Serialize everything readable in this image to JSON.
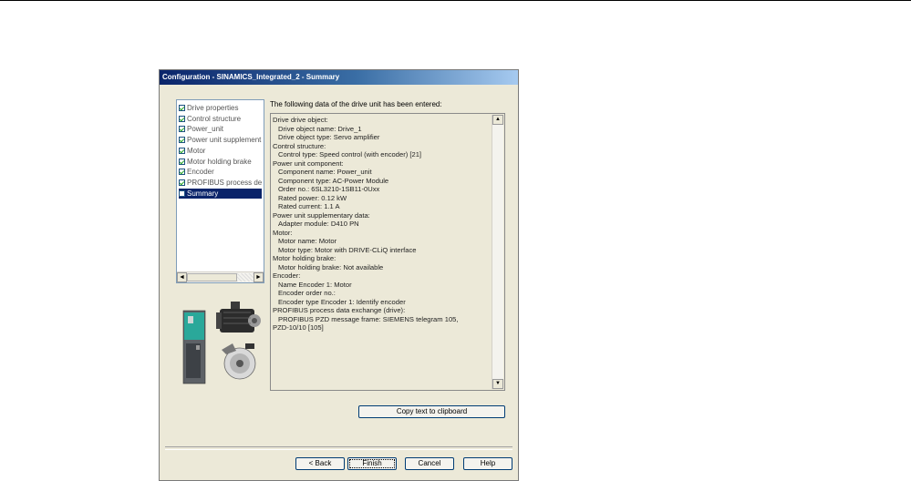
{
  "dialog": {
    "title": "Configuration - SINAMICS_Integrated_2 - Summary"
  },
  "tree": {
    "items": [
      {
        "label": "Drive properties",
        "checked": true
      },
      {
        "label": "Control structure",
        "checked": true
      },
      {
        "label": "Power_unit",
        "checked": true
      },
      {
        "label": "Power unit supplement",
        "checked": true
      },
      {
        "label": "Motor",
        "checked": true
      },
      {
        "label": "Motor holding brake",
        "checked": true
      },
      {
        "label": "Encoder",
        "checked": true
      },
      {
        "label": "PROFIBUS process de",
        "checked": true
      },
      {
        "label": "Summary",
        "checked": false,
        "selected": true
      }
    ],
    "scroll_left": "◄",
    "scroll_right": "►"
  },
  "summary": {
    "intro": "The following data of the drive unit has been entered:",
    "lines": [
      {
        "text": "Drive drive object:",
        "indent": false
      },
      {
        "text": "Drive object name: Drive_1",
        "indent": true
      },
      {
        "text": "Drive object type: Servo amplifier",
        "indent": true
      },
      {
        "text": "Control structure:",
        "indent": false
      },
      {
        "text": "Control type: Speed control (with encoder) [21]",
        "indent": true
      },
      {
        "text": "Power unit component:",
        "indent": false
      },
      {
        "text": "Component name: Power_unit",
        "indent": true
      },
      {
        "text": "Component type: AC-Power Module",
        "indent": true
      },
      {
        "text": "Order no.: 6SL3210-1SB11-0Uxx",
        "indent": true
      },
      {
        "text": "Rated power: 0.12 kW",
        "indent": true
      },
      {
        "text": "Rated current: 1.1 A",
        "indent": true
      },
      {
        "text": "Power unit supplementary data:",
        "indent": false
      },
      {
        "text": "Adapter module: D410 PN",
        "indent": true
      },
      {
        "text": "Motor:",
        "indent": false
      },
      {
        "text": "Motor name: Motor",
        "indent": true
      },
      {
        "text": "Motor type: Motor with DRIVE-CLiQ interface",
        "indent": true
      },
      {
        "text": "Motor holding brake:",
        "indent": false
      },
      {
        "text": "Motor holding brake: Not available",
        "indent": true
      },
      {
        "text": "Encoder:",
        "indent": false
      },
      {
        "text": "Name Encoder 1: Motor",
        "indent": true
      },
      {
        "text": "Encoder order no.:",
        "indent": true
      },
      {
        "text": "Encoder type Encoder 1: Identify encoder",
        "indent": true
      },
      {
        "text": "PROFIBUS process data exchange (drive):",
        "indent": false
      },
      {
        "text": "PROFIBUS PZD message frame: SIEMENS telegram 105,",
        "indent": true
      },
      {
        "text": "PZD-10/10 [105]",
        "indent": false
      }
    ],
    "scroll_up": "▲",
    "scroll_down": "▼"
  },
  "buttons": {
    "copy": "Copy text to clipboard",
    "back": "< Back",
    "finish": "Finish",
    "cancel": "Cancel",
    "help": "Help"
  }
}
